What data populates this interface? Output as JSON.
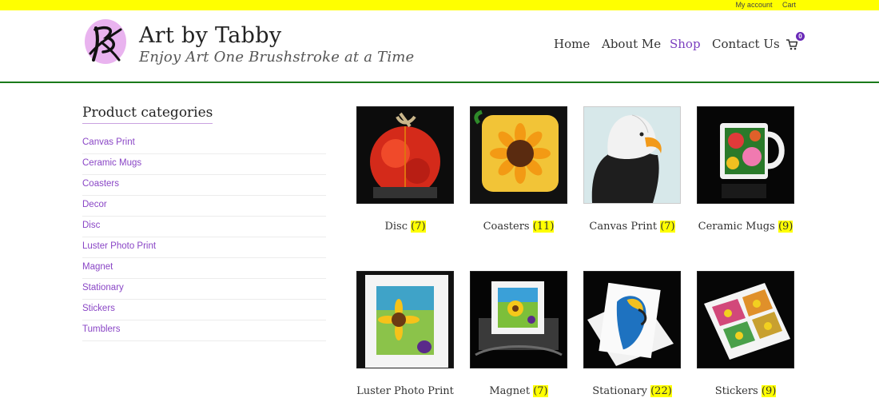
{
  "topbar": {
    "my_account": "My account",
    "cart": "Cart"
  },
  "brand": {
    "name": "Art by Tabby",
    "tagline": "Enjoy Art One Brushstroke at a Time"
  },
  "nav": {
    "items": [
      "Home",
      "About Me",
      "Shop",
      "Contact Us"
    ],
    "active": "Shop",
    "cart_count": "0"
  },
  "sidebar": {
    "title": "Product categories",
    "items": [
      "Canvas Print",
      "Ceramic Mugs",
      "Coasters",
      "Decor",
      "Disc",
      "Luster Photo Print",
      "Magnet",
      "Stationary",
      "Stickers",
      "Tumblers"
    ]
  },
  "products": [
    {
      "name": "Disc",
      "count": "(7)"
    },
    {
      "name": "Coasters",
      "count": "(11)"
    },
    {
      "name": "Canvas Print",
      "count": "(7)"
    },
    {
      "name": "Ceramic Mugs",
      "count": "(9)"
    },
    {
      "name": "Luster Photo Print",
      "count": ""
    },
    {
      "name": "Magnet",
      "count": "(7)"
    },
    {
      "name": "Stationary",
      "count": "(22)"
    },
    {
      "name": "Stickers",
      "count": "(9)"
    }
  ],
  "colors": {
    "topbar": "#ffff00",
    "accent": "#7b3fbf",
    "header_rule": "#1a7a1a",
    "count_highlight": "#ffff00"
  }
}
